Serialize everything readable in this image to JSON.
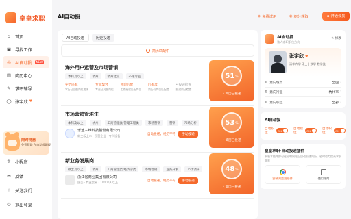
{
  "brand": {
    "name": "皇皇求职",
    "accent": "#f56a2c"
  },
  "sidebar": {
    "items": [
      {
        "label": "首页",
        "icon": "home-icon",
        "active": false
      },
      {
        "label": "寻找工作",
        "icon": "briefcase-icon",
        "active": false
      },
      {
        "label": "AI自动投",
        "icon": "ai-icon",
        "active": true,
        "badge": "NEW"
      },
      {
        "label": "简历中心",
        "icon": "resume-icon",
        "active": false
      },
      {
        "label": "求职辅导",
        "icon": "coach-icon",
        "active": false
      },
      {
        "label": "张宇欣",
        "icon": "user-icon",
        "active": false
      }
    ],
    "promo": {
      "title": "限时特惠",
      "subtitle": "免费获取 AI自动投职权"
    },
    "bottom_items": [
      {
        "label": "小程序",
        "icon": "mini-program-icon"
      },
      {
        "label": "反馈",
        "icon": "feedback-icon"
      },
      {
        "label": "关注我们",
        "icon": "follow-icon"
      },
      {
        "label": "退出登录",
        "icon": "logout-icon"
      }
    ]
  },
  "header": {
    "title": "AI自动投",
    "links": [
      "免费试用",
      "积分获取"
    ],
    "vip_label": "开通会员"
  },
  "main": {
    "tabs": [
      "AI自动投递",
      "历史投递"
    ],
    "matching_text": "简历匹配中",
    "score_label": "• 简历已投递",
    "jobs": [
      {
        "title": "海外用户运营及市场营销",
        "tags": [
          "本科及以上",
          "杭州",
          "杭州北京",
          "不限专业"
        ],
        "features": [
          {
            "label": "学历匹配",
            "sub": "学历已匹配岗位要求"
          },
          {
            "label": "专业契合",
            "sub": "专业已契合岗位"
          },
          {
            "label": "经验匹配",
            "sub": "工作经验匹配岗位"
          },
          {
            "label": "匹配度",
            "sub": "简历与岗位匹配度"
          },
          {
            "label": "• 投递检查",
            "sub": "投递前已检查"
          }
        ],
        "score": "51",
        "unit": "%"
      },
      {
        "title": "市场营销管培生",
        "tags": [
          "本科及以上",
          "杭州",
          "工商管理类·管理工程类",
          "市场营销",
          "营销",
          "市场分析"
        ],
        "company": "乐迪三维科技股份有限公司",
        "company_meta": "新三板上市 · 民营企业 · 专科设备",
        "action_text": "自动投递，经历不符",
        "apply_label": "手动投递",
        "score": "53",
        "unit": "%"
      },
      {
        "title": "新业务发展岗",
        "tags": [
          "硕士及以上",
          "杭州",
          "工商管理类·经济学类",
          "市场营销",
          "业务开发",
          "市场调研"
        ],
        "company": "浙江省商业集团有限公司",
        "company_meta": "国企 · 商业贸易 · 10000人以上",
        "action_text": "自动投递，经历不符",
        "apply_label": "手动投递",
        "score": "48",
        "unit": "%"
      }
    ]
  },
  "right": {
    "auto": {
      "title": "AI自动投",
      "subtitle": "该人求职职位方向",
      "edit_label": "修改",
      "name": "张宇欣",
      "school": "清华大学·硕士 | 数学·数学类",
      "rows": [
        {
          "label": "意向城市",
          "value": "全国"
        },
        {
          "label": "意向行业",
          "value": "杭州市"
        },
        {
          "label": "意向职位",
          "value": "全部"
        }
      ]
    },
    "ai_section": {
      "title": "AI自动投",
      "toggles": [
        {
          "label": "自动职位",
          "state": "ON"
        },
        {
          "label": "自动职位",
          "state": "ON"
        },
        {
          "label": "自动职位",
          "state": "ON"
        }
      ]
    },
    "extension": {
      "title": "皇皇求职·自动投递插件",
      "desc": "安装本插件即可在招聘网站上自动投递简历，省时省力提高求职效率",
      "buttons": [
        "安装浏览器插件",
        "使用指南"
      ]
    }
  }
}
